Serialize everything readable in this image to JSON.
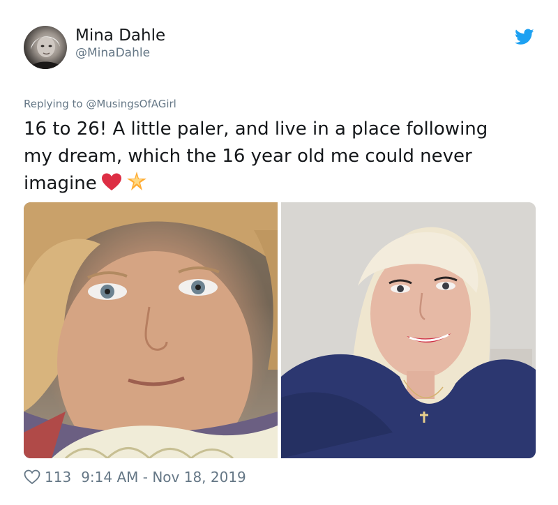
{
  "author": {
    "display_name": "Mina Dahle",
    "handle": "@MinaDahle",
    "avatar_icon": "profile-photo"
  },
  "reply": {
    "prefix": "Replying to",
    "mention": "@MusingsOfAGirl"
  },
  "tweet": {
    "lines": [
      "16 to 26! A little paler, and live in a place following",
      "my dream, which  the 16 year old me could never",
      "imagine"
    ],
    "emojis": [
      "red-heart-emoji",
      "glowing-star-emoji"
    ]
  },
  "media": {
    "photos": [
      {
        "icon": "selfie-age-16"
      },
      {
        "icon": "selfie-age-26"
      }
    ]
  },
  "stats": {
    "likes": "113",
    "timestamp": "9:14 AM - Nov 18, 2019"
  },
  "colors": {
    "twitter_blue": "#1da1f2",
    "secondary_text": "#657786",
    "primary_text": "#14171a"
  }
}
